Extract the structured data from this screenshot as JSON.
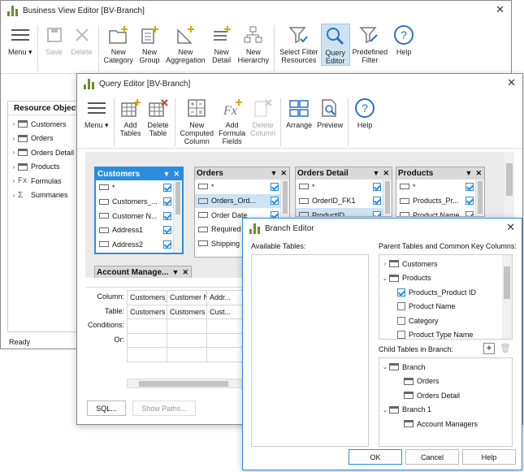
{
  "bve": {
    "title": "Business View Editor [BV-Branch]",
    "status": "Ready",
    "panel_title": "Resource Objects",
    "ribbon": [
      {
        "label": "Menu ▾",
        "icon": "menu-icon"
      },
      {
        "label": "Save",
        "icon": "save-icon",
        "disabled": true
      },
      {
        "label": "Delete",
        "icon": "delete-icon",
        "disabled": true
      },
      {
        "label": "New\nCategory",
        "icon": "new-category-icon"
      },
      {
        "label": "New\nGroup",
        "icon": "new-group-icon"
      },
      {
        "label": "New\nAggregation",
        "icon": "new-aggregation-icon"
      },
      {
        "label": "New\nDetail",
        "icon": "new-detail-icon"
      },
      {
        "label": "New\nHierarchy",
        "icon": "new-hierarchy-icon"
      },
      {
        "label": "Select Filter\nResources",
        "icon": "select-filter-icon"
      },
      {
        "label": "Query\nEditor",
        "icon": "query-editor-icon",
        "selected": true
      },
      {
        "label": "Predefined\nFilter",
        "icon": "predefined-filter-icon"
      },
      {
        "label": "Help",
        "icon": "help-icon"
      }
    ],
    "tree": [
      {
        "label": "Customers",
        "icon": "folder"
      },
      {
        "label": "Orders",
        "icon": "folder"
      },
      {
        "label": "Orders Detail",
        "icon": "folder"
      },
      {
        "label": "Products",
        "icon": "folder"
      },
      {
        "label": "Formulas",
        "icon": "fx"
      },
      {
        "label": "Summaries",
        "icon": "sigma"
      }
    ]
  },
  "qe": {
    "title": "Query Editor [BV-Branch]",
    "ribbon": [
      {
        "label": "Menu ▾",
        "icon": "menu-icon"
      },
      {
        "label": "Add\nTables",
        "icon": "add-tables-icon"
      },
      {
        "label": "Delete\nTable",
        "icon": "delete-table-icon"
      },
      {
        "label": "New\nComputed\nColumn",
        "icon": "computed-column-icon"
      },
      {
        "label": "Add\nFormula\nFields",
        "icon": "formula-fields-icon"
      },
      {
        "label": "Delete\nColumn",
        "icon": "delete-column-icon",
        "disabled": true
      },
      {
        "label": "Arrange",
        "icon": "arrange-icon"
      },
      {
        "label": "Preview",
        "icon": "preview-icon"
      },
      {
        "label": "Help",
        "icon": "help-icon"
      }
    ],
    "tables": [
      {
        "name": "Customers",
        "selected": true,
        "rows": [
          {
            "t": "*",
            "c": true
          },
          {
            "t": "Customers_...",
            "c": true
          },
          {
            "t": "Customer N...",
            "c": true
          },
          {
            "t": "Address1",
            "c": true
          },
          {
            "t": "Address2",
            "c": true
          }
        ]
      },
      {
        "name": "Orders",
        "rows": [
          {
            "t": "*",
            "c": true
          },
          {
            "t": "Orders_Ord...",
            "c": true,
            "hl": true
          },
          {
            "t": "Order Date",
            "c": true
          },
          {
            "t": "Required ...",
            "c": true
          },
          {
            "t": "Shipping ...",
            "c": true
          }
        ]
      },
      {
        "name": "Orders Detail",
        "rows": [
          {
            "t": "*",
            "c": true
          },
          {
            "t": "OrderID_FK1",
            "c": true
          },
          {
            "t": "ProductID_...",
            "c": true,
            "hl": true
          }
        ]
      },
      {
        "name": "Products",
        "rows": [
          {
            "t": "*",
            "c": true
          },
          {
            "t": "Products_Pr...",
            "c": true
          },
          {
            "t": "Product Name",
            "c": true
          }
        ]
      },
      {
        "name": "Account Manage...",
        "rows": [
          {
            "t": "*",
            "c": true
          }
        ]
      }
    ],
    "grid_labels": [
      "Column:",
      "Table:",
      "Conditions:",
      "Or:"
    ],
    "grid_cols": [
      {
        "column": "Customers_...",
        "table": "Customers"
      },
      {
        "column": "Customer N...",
        "table": "Customers"
      },
      {
        "column": "Addr...",
        "table": "Cust..."
      }
    ],
    "sql_btn": "SQL...",
    "paths_btn": "Show Paths..."
  },
  "be": {
    "title": "Branch Editor",
    "available_label": "Available Tables:",
    "parent_label": "Parent Tables and Common Key Columns:",
    "child_label": "Child Tables in Branch:",
    "parent_tree": [
      {
        "label": "Customers",
        "lvl": 0,
        "kind": "table",
        "arrow": "›"
      },
      {
        "label": "Products",
        "lvl": 0,
        "kind": "table",
        "arrow": "⌄"
      },
      {
        "label": "Products_Product ID",
        "lvl": 1,
        "kind": "check",
        "checked": true
      },
      {
        "label": "Product Name",
        "lvl": 1,
        "kind": "check",
        "checked": false
      },
      {
        "label": "Category",
        "lvl": 1,
        "kind": "check",
        "checked": false
      },
      {
        "label": "Product Type Name",
        "lvl": 1,
        "kind": "check",
        "checked": false
      }
    ],
    "child_tree": [
      {
        "label": "Branch",
        "lvl": 0,
        "kind": "folder",
        "arrow": "⌄"
      },
      {
        "label": "Orders",
        "lvl": 1,
        "kind": "table"
      },
      {
        "label": "Orders Detail",
        "lvl": 1,
        "kind": "table"
      },
      {
        "label": "Branch 1",
        "lvl": 0,
        "kind": "folder",
        "arrow": "⌄"
      },
      {
        "label": "Account Managers",
        "lvl": 1,
        "kind": "table"
      }
    ],
    "ok": "OK",
    "cancel": "Cancel",
    "help": "Help"
  },
  "colors": {
    "accent": "#2a8de0",
    "selection": "#cde3f4",
    "brand_green": "#6a8e2e"
  }
}
